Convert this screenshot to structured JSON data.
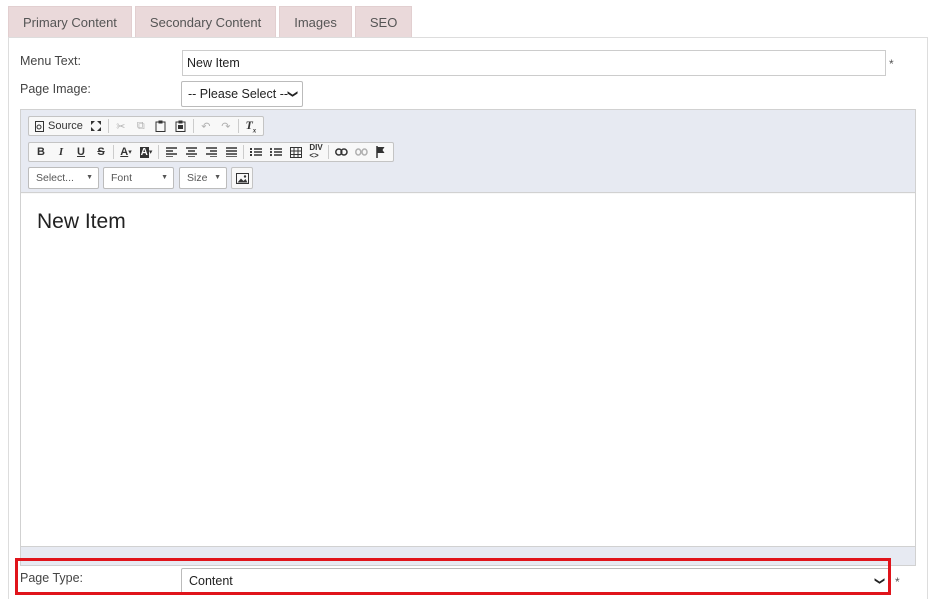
{
  "tabs": [
    {
      "label": "Primary Content"
    },
    {
      "label": "Secondary Content"
    },
    {
      "label": "Images"
    },
    {
      "label": "SEO"
    }
  ],
  "form": {
    "menu_text_label": "Menu Text:",
    "menu_text_value": "New Item",
    "required_mark": "*",
    "page_image_label": "Page Image:",
    "page_image_value": "-- Please Select --",
    "page_type_label": "Page Type:",
    "page_type_value": "Content"
  },
  "editor": {
    "source_label": "Source",
    "format_combo": "Select...",
    "font_combo": "Font",
    "size_combo": "Size",
    "content_heading": "New Item"
  },
  "colors": {
    "tab_bg": "#ead9da",
    "toolbar_bg": "#e7eaf2",
    "highlight": "#e0141b"
  }
}
